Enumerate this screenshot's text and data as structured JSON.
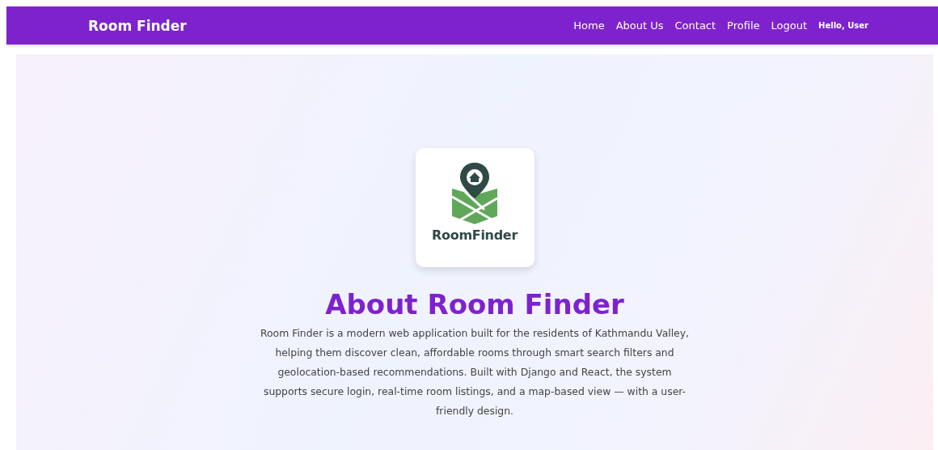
{
  "navbar": {
    "brand": "Room Finder",
    "links": [
      {
        "label": "Home"
      },
      {
        "label": "About Us"
      },
      {
        "label": "Contact"
      },
      {
        "label": "Profile"
      },
      {
        "label": "Logout"
      }
    ],
    "greeting": "Hello, User"
  },
  "about": {
    "logo_text": "RoomFinder",
    "title": "About Room Finder",
    "description": "Room Finder is a modern web application built for the residents of Kathmandu Valley, helping them discover clean, affordable rooms through smart search filters and geolocation-based recommendations. Built with Django and React, the system supports secure login, real-time room listings, and a map-based view — with a user-friendly design."
  }
}
